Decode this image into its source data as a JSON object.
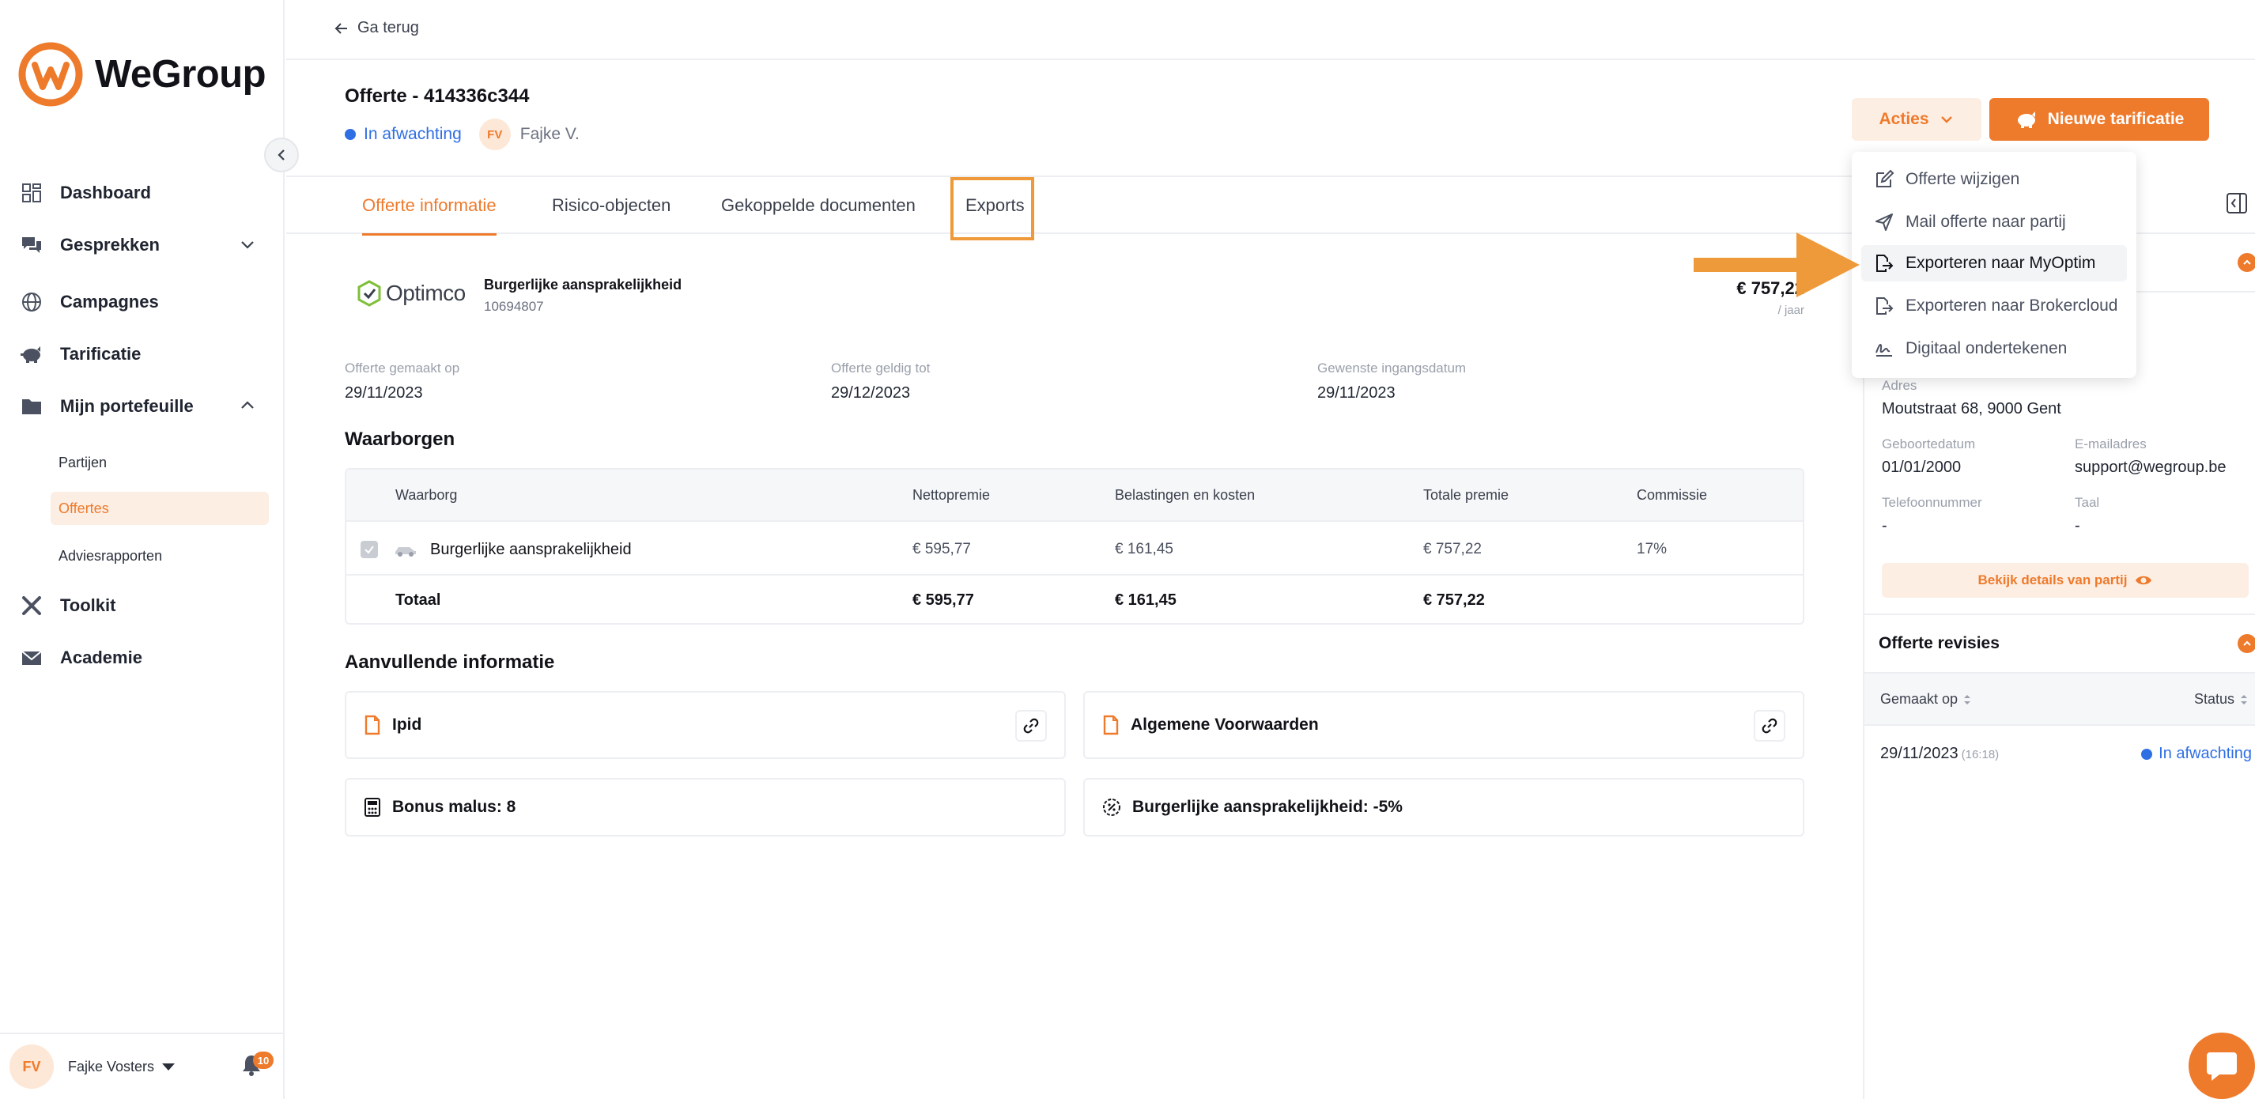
{
  "brand": {
    "name": "WeGroup",
    "accent": "#ee7a2b",
    "status_blue": "#2f6fe4"
  },
  "sidebar": {
    "items": [
      {
        "label": "Dashboard",
        "icon": "dashboard-icon"
      },
      {
        "label": "Gesprekken",
        "icon": "chat-icon"
      },
      {
        "label": "Campagnes",
        "icon": "globe-icon"
      },
      {
        "label": "Tarificatie",
        "icon": "piggy-bank-icon"
      },
      {
        "label": "Mijn portefeuille",
        "icon": "folder-icon"
      },
      {
        "label": "Toolkit",
        "icon": "tools-icon"
      },
      {
        "label": "Academie",
        "icon": "mail-icon"
      }
    ],
    "sub_items": [
      "Partijen",
      "Offertes",
      "Adviesrapporten"
    ],
    "user": {
      "initials": "FV",
      "name": "Fajke Vosters",
      "notifications": "10"
    }
  },
  "topbar": {
    "back_label": "Ga terug"
  },
  "header": {
    "title": "Offerte - 414336c344",
    "status": "In afwachting",
    "owner_initials": "FV",
    "owner": "Fajke V.",
    "acties_label": "Acties",
    "new_label": "Nieuwe tarificatie"
  },
  "dropdown": {
    "items": [
      "Offerte wijzigen",
      "Mail offerte naar partij",
      "Exporteren naar MyOptim",
      "Exporteren naar Brokercloud",
      "Digitaal ondertekenen"
    ]
  },
  "tabs": [
    "Offerte informatie",
    "Risico-objecten",
    "Gekoppelde documenten",
    "Exports"
  ],
  "product": {
    "insurer": "Optimco",
    "name": "Burgerlijke aansprakelijkheid",
    "number": "10694807",
    "price": "€ 757,22",
    "period": "/ jaar"
  },
  "meta": [
    {
      "label": "Offerte gemaakt op",
      "value": "29/11/2023"
    },
    {
      "label": "Offerte geldig tot",
      "value": "29/12/2023"
    },
    {
      "label": "Gewenste ingangsdatum",
      "value": "29/11/2023"
    }
  ],
  "waarborgen": {
    "title": "Waarborgen",
    "headers": [
      "Waarborg",
      "Nettopremie",
      "Belastingen en kosten",
      "Totale premie",
      "Commissie"
    ],
    "row": [
      "Burgerlijke aansprakelijkheid",
      "€ 595,77",
      "€ 161,45",
      "€ 757,22",
      "17%"
    ],
    "total": [
      "Totaal",
      "€ 595,77",
      "€ 161,45",
      "€ 757,22"
    ]
  },
  "aanvullend": {
    "title": "Aanvullende informatie",
    "cards": [
      "Ipid",
      "Algemene Voorwaarden",
      "Bonus malus: 8",
      "Burgerlijke aansprakelijkheid: -5%"
    ]
  },
  "right_panel": {
    "fields": [
      {
        "label": "Adres",
        "value": "Moutstraat 68, 9000 Gent"
      },
      {
        "label": "Geboortedatum",
        "value": "01/01/2000"
      },
      {
        "label": "E-mailadres",
        "value": "support@wegroup.be"
      },
      {
        "label": "Telefoonnummer",
        "value": "-"
      },
      {
        "label": "Taal",
        "value": "-"
      }
    ],
    "details_label": "Bekijk details van partij",
    "revisions_title": "Offerte revisies",
    "rev_headers": [
      "Gemaakt op",
      "Status"
    ],
    "rev_row": {
      "date": "29/11/2023",
      "time": "(16:18)",
      "status": "In afwachting"
    }
  }
}
